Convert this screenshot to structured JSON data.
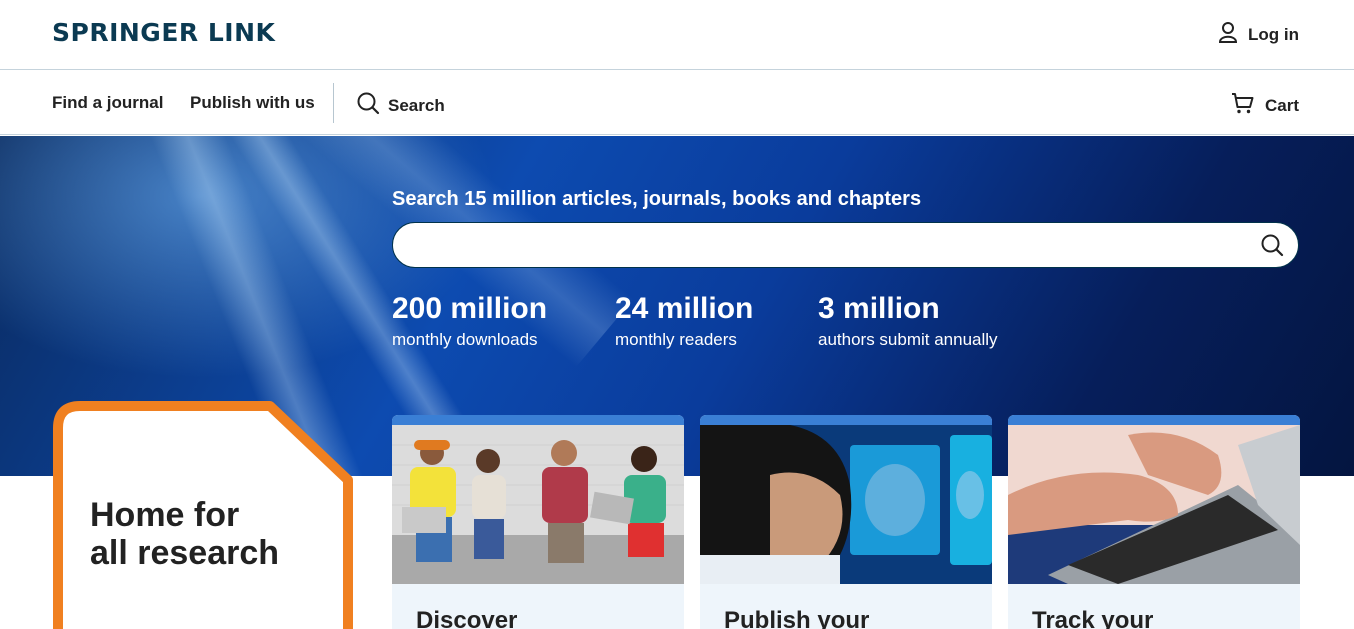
{
  "header": {
    "logo_text": "SPRINGER LINK",
    "login_label": "Log in"
  },
  "nav": {
    "find_journal": "Find a journal",
    "publish": "Publish with us",
    "search": "Search",
    "cart": "Cart"
  },
  "hero": {
    "title": "Search 15 million articles, journals, books and chapters",
    "search_placeholder": "",
    "stats": [
      {
        "value": "200 million",
        "label": "monthly downloads"
      },
      {
        "value": "24 million",
        "label": "monthly readers"
      },
      {
        "value": "3 million",
        "label": "authors submit annually"
      }
    ]
  },
  "home": {
    "line1": "Home for",
    "line2": "all research"
  },
  "cards": [
    {
      "title": "Discover"
    },
    {
      "title": "Publish your"
    },
    {
      "title": "Track your"
    }
  ],
  "colors": {
    "brand": "#01324b",
    "accent_orange": "#f08020",
    "hero_blue": "#0d4bb0",
    "card_bg": "#eef5fb"
  },
  "icons": [
    "user-icon",
    "search-icon",
    "cart-icon"
  ]
}
